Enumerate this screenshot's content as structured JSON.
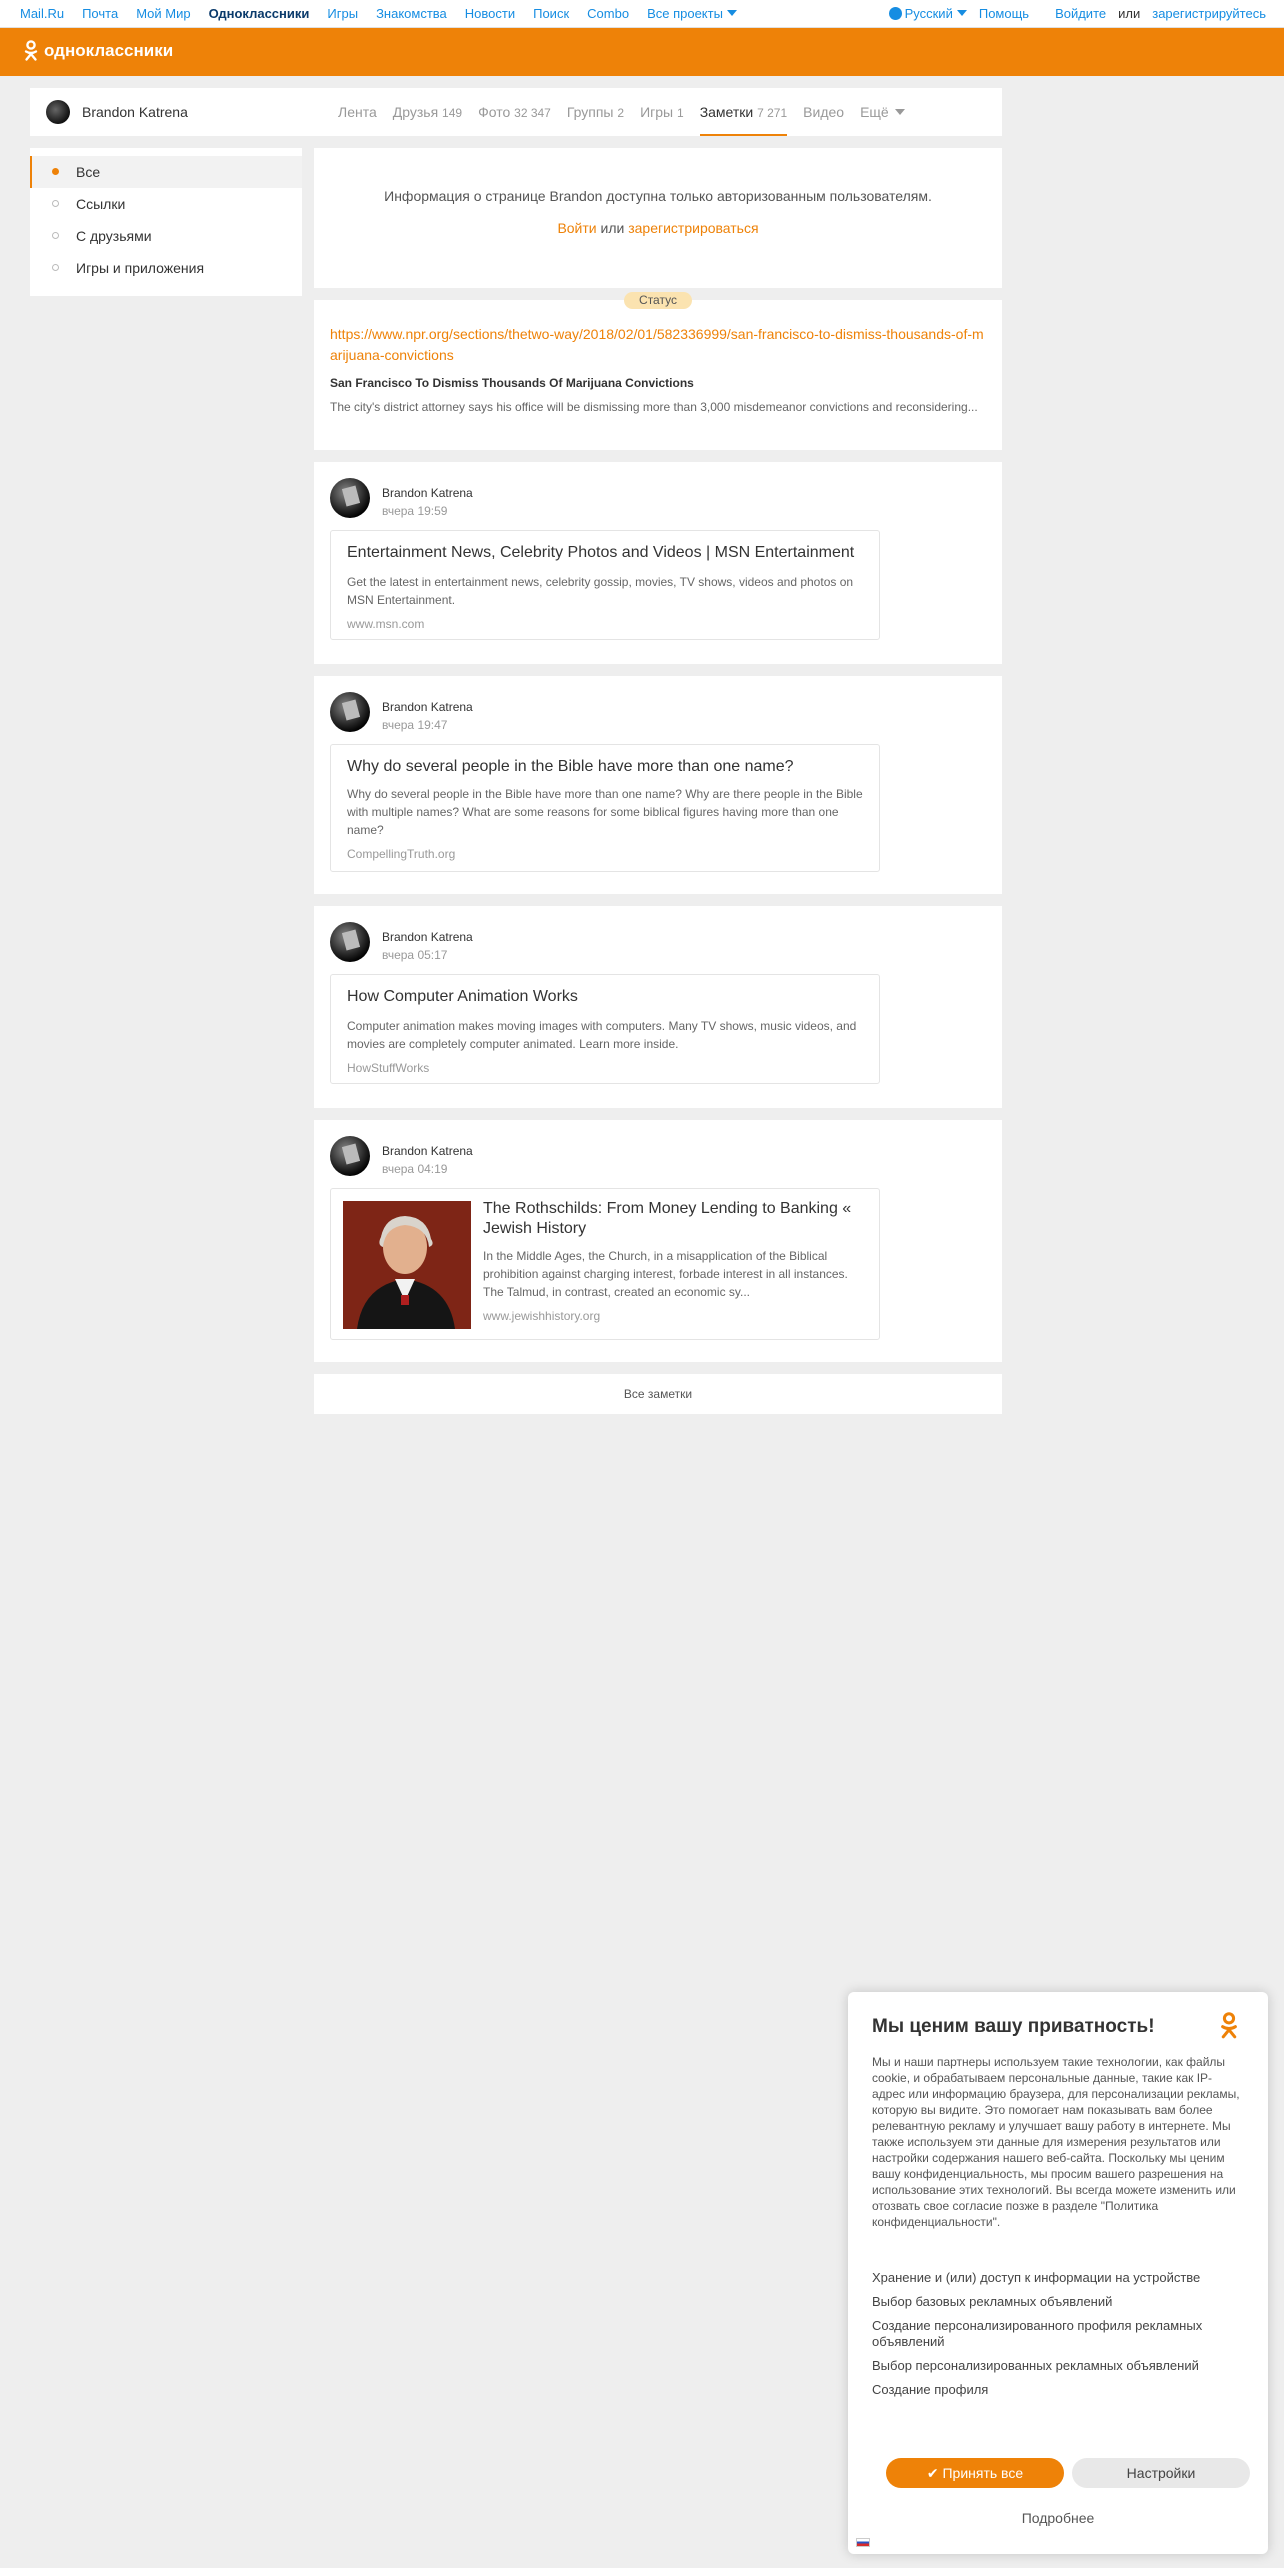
{
  "portal": {
    "nav": [
      "Mail.Ru",
      "Почта",
      "Мой Мир",
      "Одноклассники",
      "Игры",
      "Знакомства",
      "Новости",
      "Поиск",
      "Combo",
      "Все проекты"
    ],
    "language": "Русский",
    "help": "Помощь",
    "login": "Войдите",
    "or": "или",
    "register": "зарегистрируйтесь"
  },
  "header": {
    "logo_text": "одноклассники",
    "brand_color": "#ee8208"
  },
  "profile": {
    "name": "Brandon Katrena",
    "tabs": [
      {
        "label": "Лента",
        "count": ""
      },
      {
        "label": "Друзья",
        "count": "149"
      },
      {
        "label": "Фото",
        "count": "32 347"
      },
      {
        "label": "Группы",
        "count": "2"
      },
      {
        "label": "Игры",
        "count": "1"
      },
      {
        "label": "Заметки",
        "count": "7 271"
      },
      {
        "label": "Видео",
        "count": ""
      },
      {
        "label": "Ещё",
        "count": ""
      }
    ]
  },
  "sidebar": {
    "items": [
      "Все",
      "Ссылки",
      "С друзьями",
      "Игры и приложения"
    ]
  },
  "info": {
    "message": "Информация о странице Brandon доступна только авторизованным пользователям.",
    "login": "Войти",
    "or": "или",
    "register": "зарегистрироваться"
  },
  "status": {
    "pill": "Статус",
    "url": "https://www.npr.org/sections/thetwo-way/2018/02/01/582336999/san-francisco-to-dismiss-thousands-of-marijuana-convictions",
    "title": "San Francisco To Dismiss Thousands Of Marijuana Convictions",
    "desc": "The city's district attorney says his office will be dismissing more than 3,000 misdemeanor convictions and reconsidering..."
  },
  "posts": [
    {
      "author": "Brandon Katrena",
      "time": "вчера 19:59",
      "title": "Entertainment News, Celebrity Photos and Videos | MSN Entertainment",
      "desc": "Get the latest in entertainment news, celebrity gossip, movies, TV shows, videos and photos on MSN Entertainment.",
      "domain": "www.msn.com"
    },
    {
      "author": "Brandon Katrena",
      "time": "вчера 19:47",
      "title": "Why do several people in the Bible have more than one name?",
      "desc": "Why do several people in the Bible have more than one name? Why are there people in the Bible with multiple names? What are some reasons for some biblical figures having more than one name?",
      "domain": "CompellingTruth.org"
    },
    {
      "author": "Brandon Katrena",
      "time": "вчера 05:17",
      "title": "How Computer Animation Works",
      "desc": "Computer animation makes moving images with computers. Many TV shows, music videos, and movies are completely computer animated. Learn more inside.",
      "domain": "HowStuffWorks"
    },
    {
      "author": "Brandon Katrena",
      "time": "вчера 04:19",
      "title": "The Rothschilds: From Money Lending to Banking « Jewish History",
      "desc": "In the Middle Ages, the Church, in a misapplication of the Biblical prohibition against charging interest, forbade interest in all instances. The Talmud, in contrast, created an economic sy...",
      "domain": "www.jewishhistory.org"
    }
  ],
  "all_notes": "Все заметки",
  "privacy": {
    "title": "Мы ценим вашу приватность!",
    "body": "Мы и наши партнеры используем такие технологии, как файлы cookie, и обрабатываем персональные данные, такие как IP-адрес или информацию браузера, для персонализации рекламы, которую вы видите. Это помогает нам показывать вам более релевантную рекламу и улучшает вашу работу в интернете. Мы также используем эти данные для измерения результатов или настройки содержания нашего веб-сайта. Поскольку мы ценим вашу конфиденциальность, мы просим вашего разрешения на использование этих технологий. Вы всегда можете изменить или отозвать свое согласие позже в разделе \"Политика конфиденциальности\".",
    "purposes": [
      "Хранение и (или) доступ к информации на устройстве",
      "Выбор базовых рекламных объявлений",
      "Создание персонализированного профиля рекламных объявлений",
      "Выбор персонализированных рекламных объявлений",
      "Создание профиля"
    ],
    "accept": "Принять все",
    "settings": "Настройки",
    "more": "Подробнее"
  }
}
